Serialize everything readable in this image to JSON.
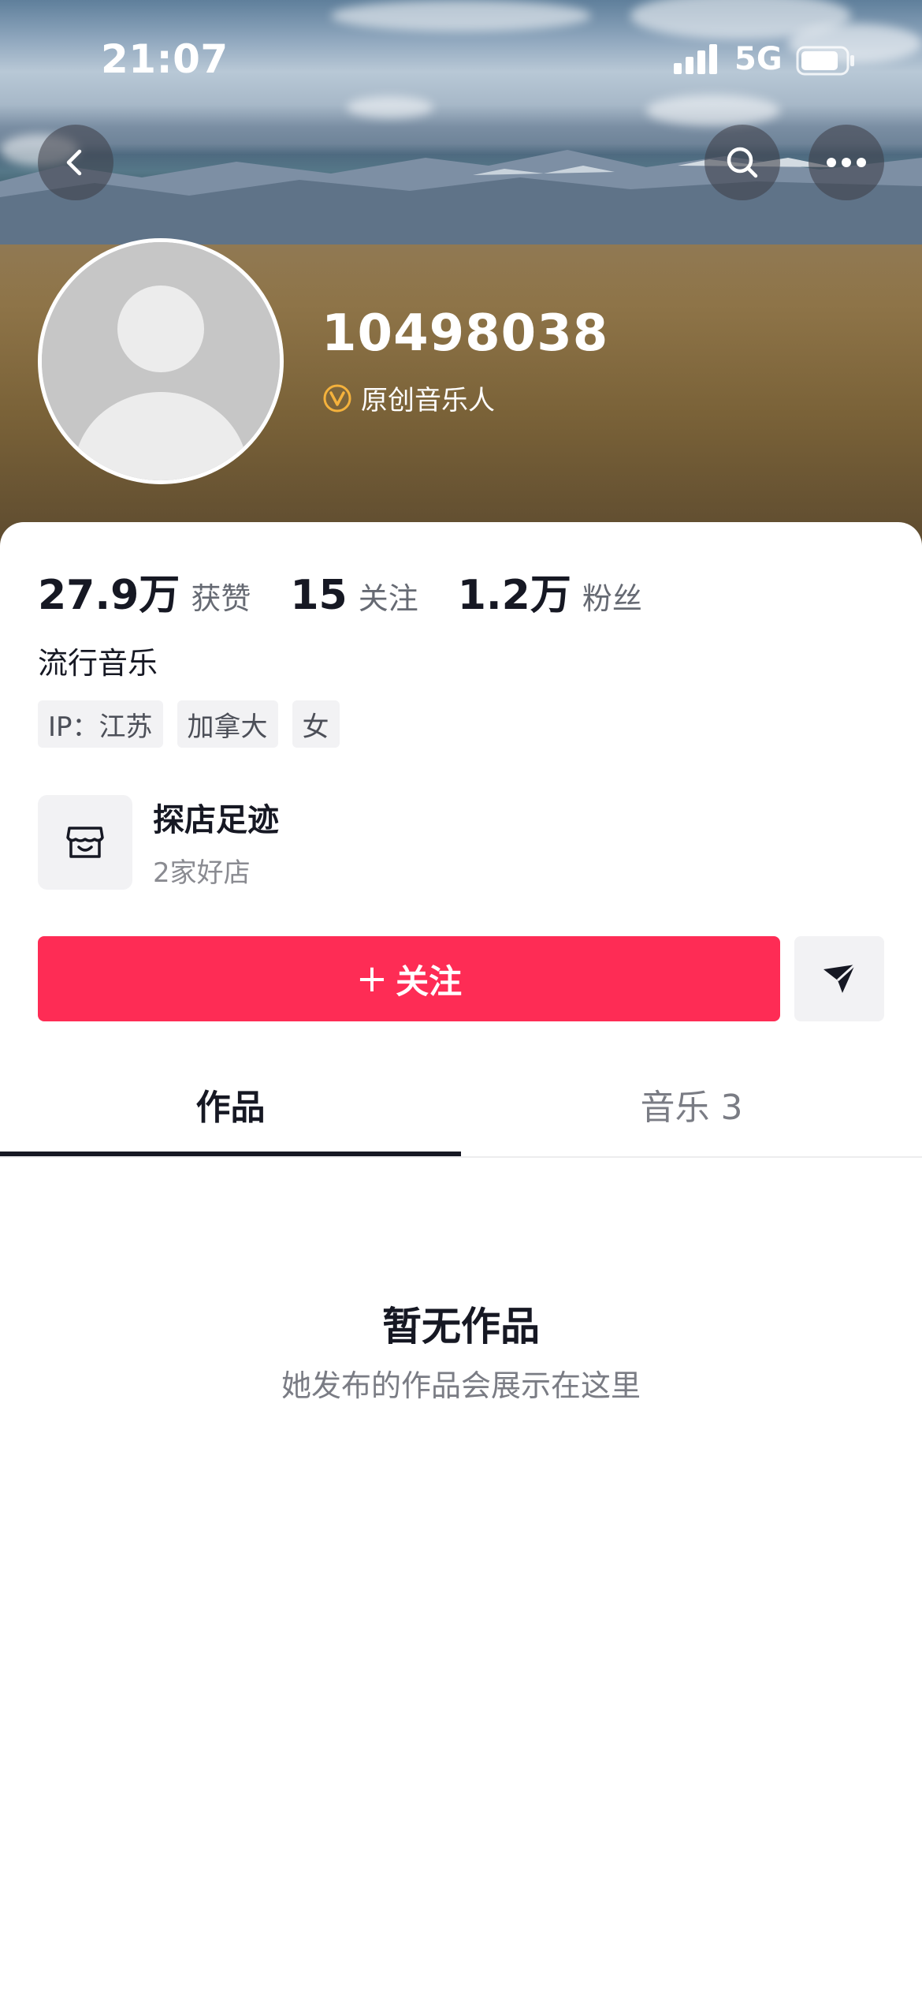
{
  "status_bar": {
    "time": "21:07",
    "network": "5G"
  },
  "header": {
    "back_icon": "chevron-left-icon",
    "search_icon": "search-icon",
    "more_icon": "more-dots-icon"
  },
  "profile": {
    "username": "10498038",
    "verify_label": "原创音乐人",
    "verify_color": "#f5b23c"
  },
  "stats": [
    {
      "value": "27.9万",
      "label": "获赞"
    },
    {
      "value": "15",
      "label": "关注"
    },
    {
      "value": "1.2万",
      "label": "粉丝"
    }
  ],
  "bio": "流行音乐",
  "tags": [
    "IP：江苏",
    "加拿大",
    "女"
  ],
  "shop": {
    "title": "探店足迹",
    "subtitle": "2家好店"
  },
  "actions": {
    "follow_plus": "+",
    "follow_label": "关注",
    "accent_color": "#fe2c55"
  },
  "tabs": [
    {
      "label": "作品"
    },
    {
      "label": "音乐 3"
    }
  ],
  "empty_state": {
    "title": "暂无作品",
    "subtitle": "她发布的作品会展示在这里"
  }
}
